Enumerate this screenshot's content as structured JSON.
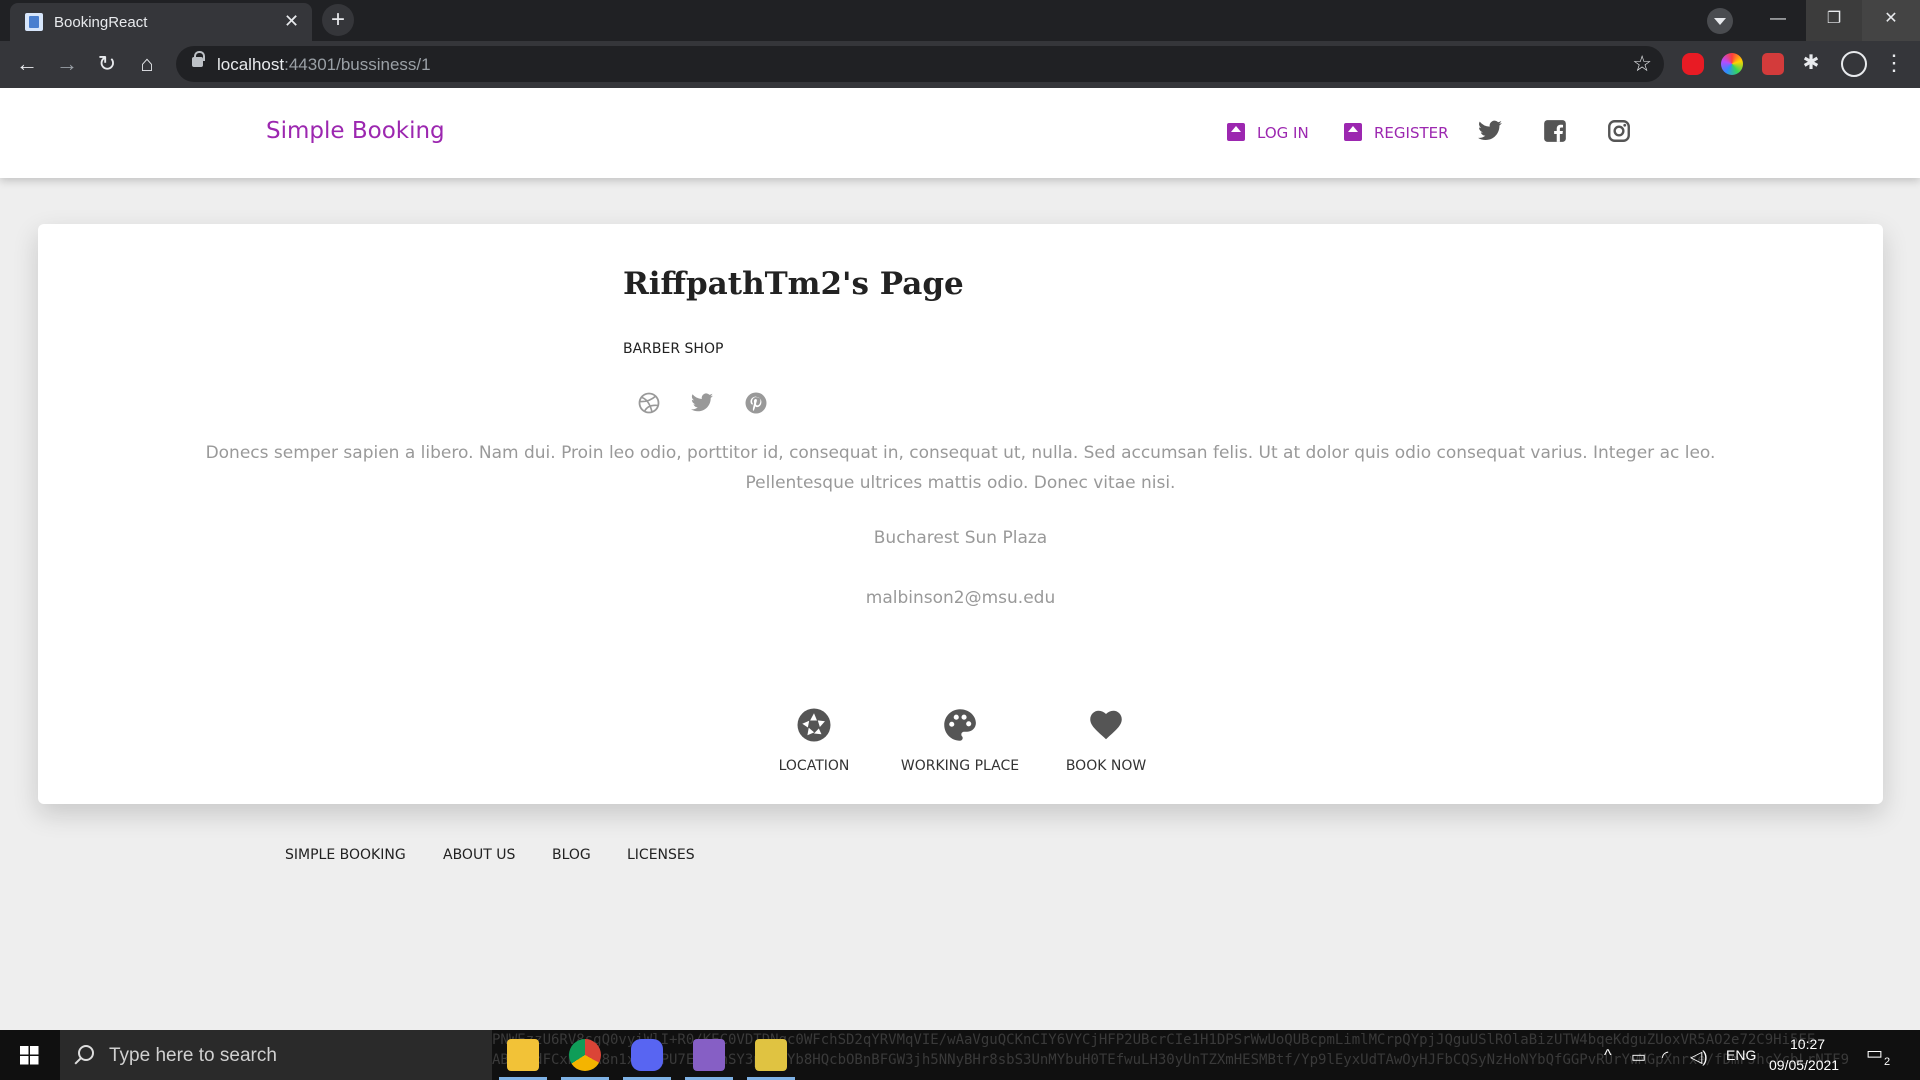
{
  "browser": {
    "tab_title": "BookingReact",
    "tab_close": "✕",
    "new_tab": "+",
    "url_host": "localhost",
    "url_path": ":44301/bussiness/1",
    "nav_back": "←",
    "nav_forward": "→",
    "nav_reload": "↻",
    "nav_home": "⌂",
    "star": "☆",
    "extension_puzzle": "✱",
    "menu": "⋮",
    "win_minimize": "—",
    "win_restore": "❐",
    "win_close": "✕"
  },
  "site": {
    "brand": "Simple Booking",
    "nav": {
      "login": "LOG IN",
      "register": "REGISTER"
    },
    "accent_color": "#9c27b0",
    "social_icons": [
      "twitter-icon",
      "facebook-icon",
      "instagram-icon"
    ]
  },
  "profile": {
    "name": "RiffpathTm2's Page",
    "category": "BARBER SHOP",
    "social_icons": [
      "dribbble-icon",
      "twitter-icon",
      "pinterest-icon"
    ],
    "description_line1": "Donecs semper sapien a libero. Nam dui. Proin leo odio, porttitor id, consequat in, consequat ut, nulla. Sed accumsan felis. Ut at dolor quis odio consequat varius. Integer ac leo.",
    "description_line2": "Pellentesque ultrices mattis odio. Donec vitae nisi.",
    "address": "Bucharest Sun Plaza",
    "email": "malbinson2@msu.edu",
    "actions": [
      {
        "label": "LOCATION",
        "icon": "camera-aperture-icon"
      },
      {
        "label": "WORKING PLACE",
        "icon": "palette-icon"
      },
      {
        "label": "BOOK NOW",
        "icon": "heart-icon"
      }
    ]
  },
  "footer": {
    "links": [
      "SIMPLE BOOKING",
      "ABOUT US",
      "BLOG",
      "LICENSES"
    ]
  },
  "taskbar": {
    "search_placeholder": "Type here to search",
    "noise_line1": "PNWEzzU6RV8sgQ0vyiWlI+R0/KEC0VDTDNgc0WFchSD2qYRVMqVIE/wAaVguQCKnCIY6VYCjHFP2UBcrCIe1H1DPSrWwUoQUBcpmLimlMCrpQYpjJQguUSlROlaBizUTW4bqeKdguZUoxVR5AO2e72C9Hi5EE",
    "noise_line2": "ABKpBdFCxHAdA8n1xPvFPU7E4nIhSY3pvBnYb8HQcbOBnBFGW3jh5NNyBHr8sbS3UnMYbuH0TEfwuLH30yUnTZXmHESMBtf/Yp9lEyxUdTAwOyHJFbCQSyNzHoNYbQfGGPvRUrYwMGpXnrxe/fDmFJhcYcbLrNTF9",
    "language": "ENG",
    "time": "10:27",
    "date": "09/05/2021",
    "notification_count": "2"
  }
}
